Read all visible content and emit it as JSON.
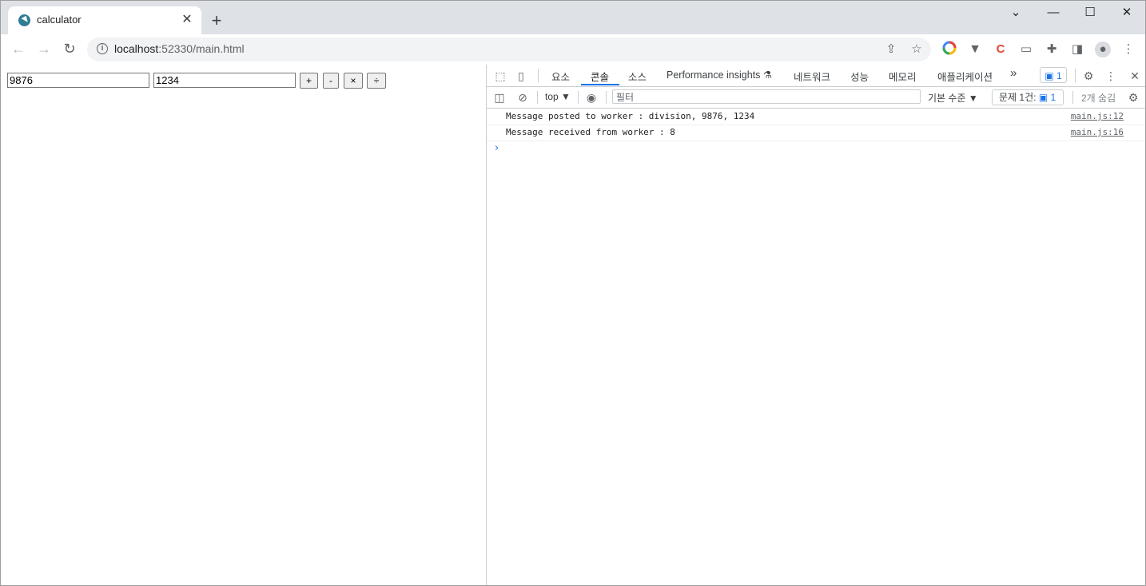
{
  "browser": {
    "tab": {
      "title": "calculator",
      "close": "✕"
    },
    "new_tab": "+",
    "window_controls": {
      "tabsearch": "⌄",
      "minimize": "—",
      "maximize": "☐",
      "close": "✕"
    },
    "url": {
      "host": "localhost",
      "rest": ":52330/main.html"
    }
  },
  "page": {
    "input1": "9876",
    "input2": "1234",
    "buttons": {
      "add": "+",
      "subtract": "-",
      "multiply": "×",
      "divide": "÷"
    }
  },
  "devtools": {
    "tabs": [
      "요소",
      "콘솔",
      "소스",
      "Performance insights ⚗",
      "네트워크",
      "성능",
      "메모리",
      "애플리케이션"
    ],
    "more": "»",
    "issues_badge": "1",
    "toolbar": {
      "context": "top ▼",
      "filter_placeholder": "필터",
      "levels": "기본 수준 ▼",
      "issues_label": "문제 1건:",
      "issues_count": "1",
      "hidden": "2개 숨김"
    },
    "console": [
      {
        "message": "Message posted to worker : division, 9876, 1234",
        "source": "main.js:12"
      },
      {
        "message": "Message received from worker : 8",
        "source": "main.js:16"
      }
    ],
    "prompt": "›"
  }
}
